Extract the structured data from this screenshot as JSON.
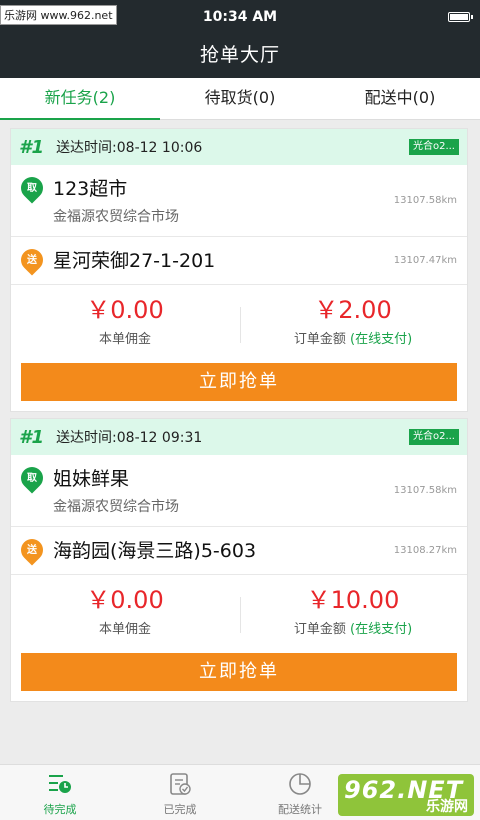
{
  "watermark_top": "乐游网 www.962.net",
  "status": {
    "time": "10:34 AM",
    "battery_level": 0.9
  },
  "header": {
    "title": "抢单大厅"
  },
  "tabs": [
    {
      "label": "新任务(2)"
    },
    {
      "label": "待取货(0)"
    },
    {
      "label": "配送中(0)"
    }
  ],
  "orders": [
    {
      "num": "#1",
      "time": "送达时间:08-12 10:06",
      "tag": "光合o2...",
      "pickup": {
        "icon_label": "取",
        "name": "123超市",
        "address": "金福源农贸综合市场",
        "distance": "13107.58km"
      },
      "deliver": {
        "icon_label": "送",
        "name": "星河荣御27-1-201",
        "distance": "13107.47km"
      },
      "commission": "￥0.00",
      "commission_label": "本单佣金",
      "amount": "￥2.00",
      "amount_label": "订单金额",
      "pay_hint": "(在线支付)",
      "grab_label": "立即抢单"
    },
    {
      "num": "#1",
      "time": "送达时间:08-12 09:31",
      "tag": "光合o2...",
      "pickup": {
        "icon_label": "取",
        "name": "姐妹鲜果",
        "address": "金福源农贸综合市场",
        "distance": "13107.58km"
      },
      "deliver": {
        "icon_label": "送",
        "name": "海韵园(海景三路)5-603",
        "distance": "13108.27km"
      },
      "commission": "￥0.00",
      "commission_label": "本单佣金",
      "amount": "￥10.00",
      "amount_label": "订单金额",
      "pay_hint": "(在线支付)",
      "grab_label": "立即抢单"
    }
  ],
  "bottom_nav": [
    {
      "label": "待完成",
      "icon": "pending-icon"
    },
    {
      "label": "已完成",
      "icon": "completed-icon"
    },
    {
      "label": "配送统计",
      "icon": "pie-chart-icon"
    }
  ],
  "watermark_bottom": {
    "big": "962.NET",
    "small": "乐游网"
  },
  "colors": {
    "accent": "#1aa34a",
    "button": "#f38a1b",
    "price": "#e8262a",
    "header": "#232a2e"
  }
}
